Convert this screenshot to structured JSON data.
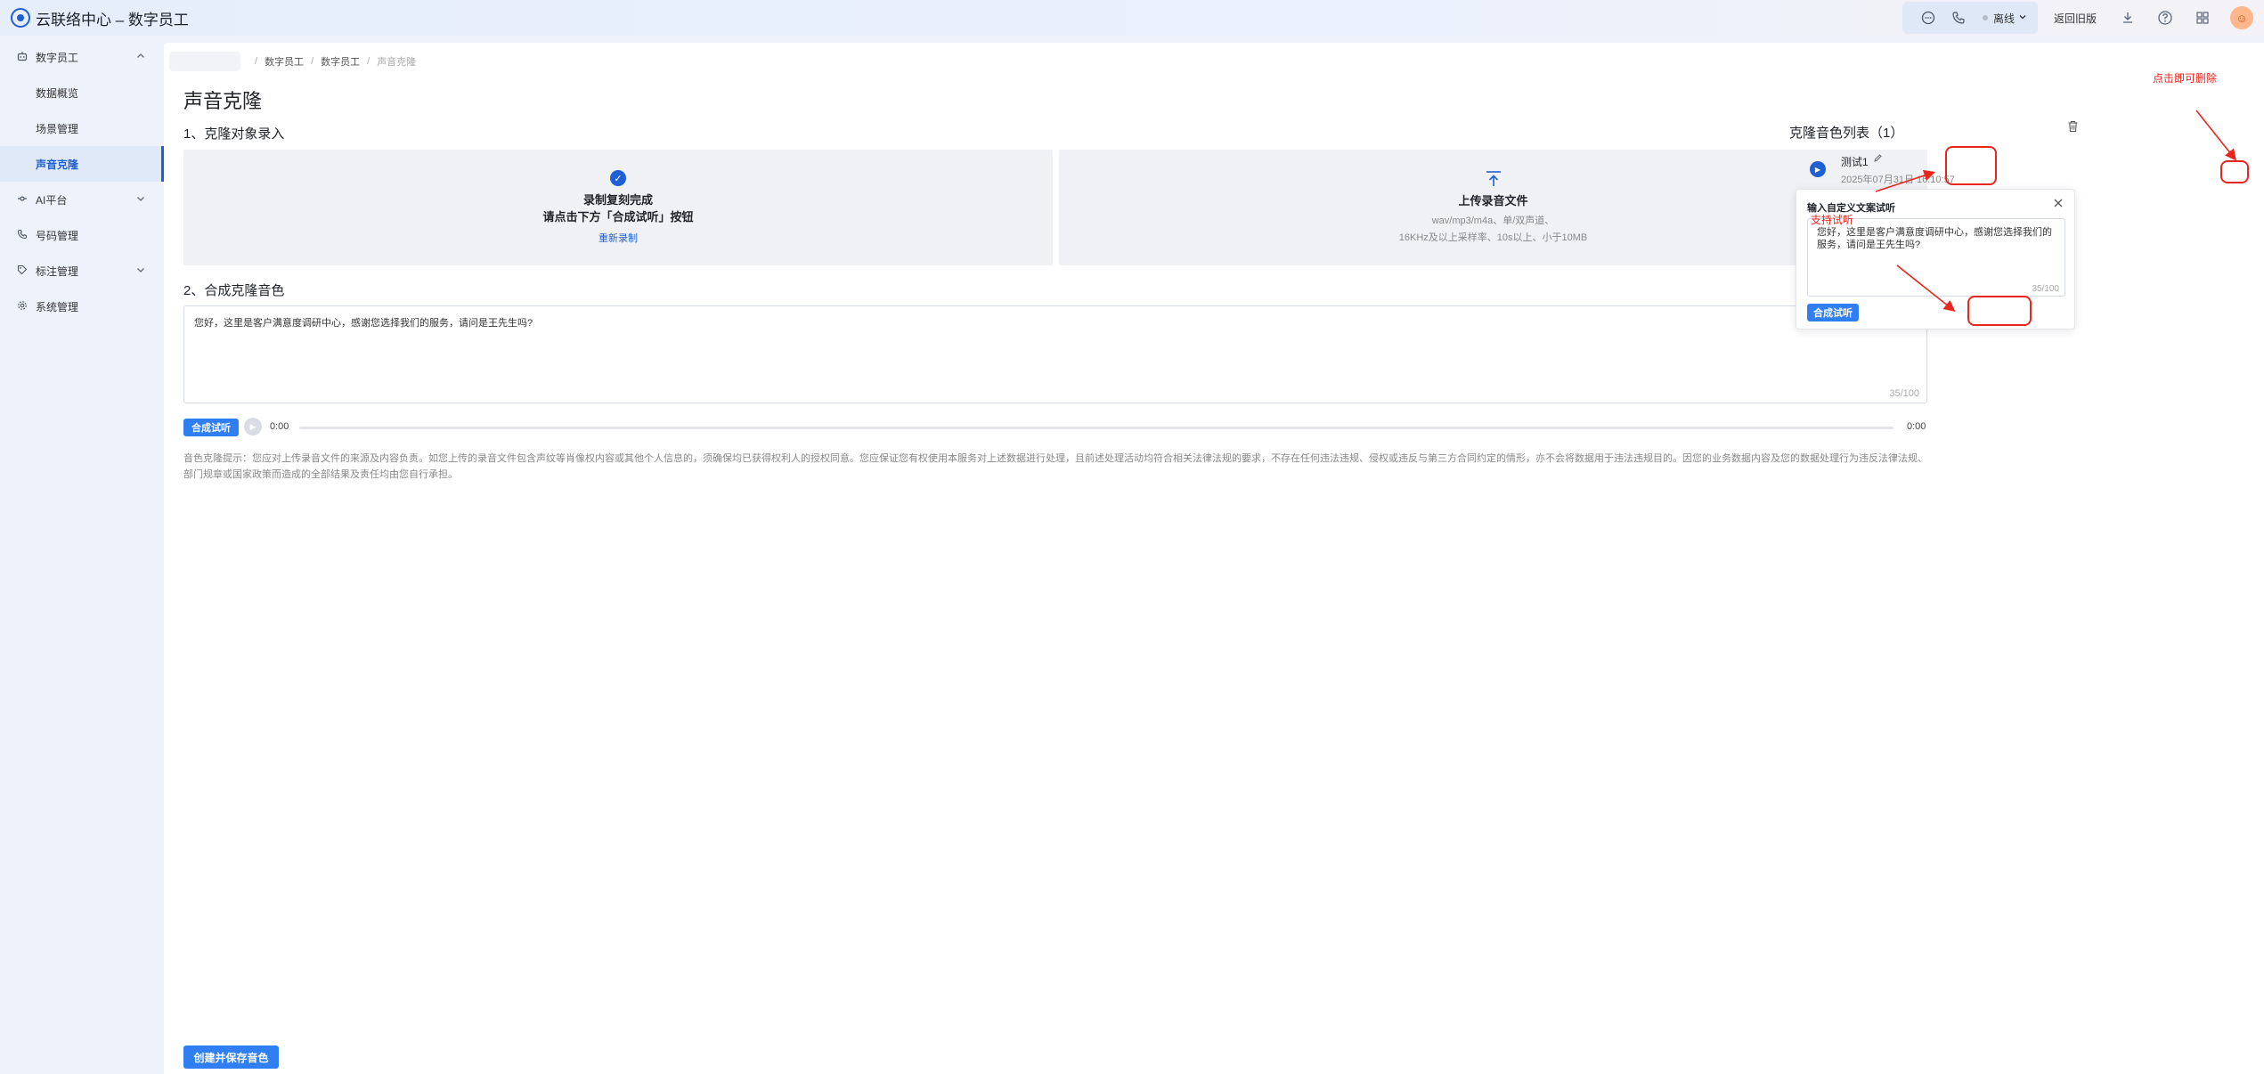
{
  "app": {
    "title": "云联络中心 – 数字员工"
  },
  "topbar": {
    "status": "离线",
    "back_link": "返回旧版",
    "icons": [
      "chat-icon",
      "phone-icon",
      "download-icon",
      "help-icon",
      "grid-icon"
    ]
  },
  "sidebar": {
    "items": [
      {
        "label": "数字员工",
        "icon": "robot-icon",
        "type": "group",
        "expanded": true
      },
      {
        "label": "数据概览",
        "type": "sub"
      },
      {
        "label": "场景管理",
        "type": "sub"
      },
      {
        "label": "声音克隆",
        "type": "sub",
        "active": true
      },
      {
        "label": "AI平台",
        "icon": "ai-icon",
        "type": "group",
        "expanded": false
      },
      {
        "label": "号码管理",
        "icon": "phone-icon",
        "type": "group"
      },
      {
        "label": "标注管理",
        "icon": "tag-icon",
        "type": "group",
        "expanded": false
      },
      {
        "label": "系统管理",
        "icon": "settings-icon",
        "type": "group"
      }
    ]
  },
  "breadcrumb": {
    "items": [
      "数字员工",
      "数字员工"
    ],
    "current": "声音克隆"
  },
  "page": {
    "title": "声音克隆",
    "section1_title": "1、克隆对象录入",
    "record_card": {
      "line1": "录制复刻完成",
      "line2": "请点击下方「合成试听」按钮",
      "link": "重新录制"
    },
    "upload_card": {
      "title": "上传录音文件",
      "line1": "wav/mp3/m4a、单/双声道、",
      "line2": "16KHz及以上采样率、10s以上、小于10MB"
    },
    "section2_title": "2、合成克隆音色",
    "text_value": "您好，这里是客户满意度调研中心，感谢您选择我们的服务，请问是王先生吗?",
    "text_count": "35/100",
    "synth_button": "合成试听",
    "time_start": "0:00",
    "time_end": "0:00",
    "progress": 0,
    "notice": "音色克隆提示：您应对上传录音文件的来源及内容负责。如您上传的录音文件包含声纹等肖像权内容或其他个人信息的，须确保均已获得权利人的授权同意。您应保证您有权使用本服务对上述数据进行处理，且前述处理活动均符合相关法律法规的要求，不存在任何违法违规、侵权或违反与第三方合同约定的情形，亦不会将数据用于违法违规目的。因您的业务数据内容及您的数据处理行为违反法律法规、部门规章或国家政策而造成的全部结果及责任均由您自行承担。",
    "save_button": "创建并保存音色"
  },
  "voice_list": {
    "title": "克隆音色列表（1）",
    "items": [
      {
        "name": "测试1",
        "time": "2025年07月31日 16:10:57"
      }
    ]
  },
  "popover": {
    "title": "输入自定义文案试听",
    "text": "您好，这里是客户满意度调研中心，感谢您选择我们的服务，请问是王先生吗?",
    "count": "35/100",
    "button": "合成试听"
  },
  "annotations": {
    "delete_hint": "点击即可删除",
    "preview_hint": "支持试听"
  },
  "colors": {
    "primary": "#2f7ef2",
    "brand": "#1f5fd1",
    "annotation": "#e8261d"
  }
}
